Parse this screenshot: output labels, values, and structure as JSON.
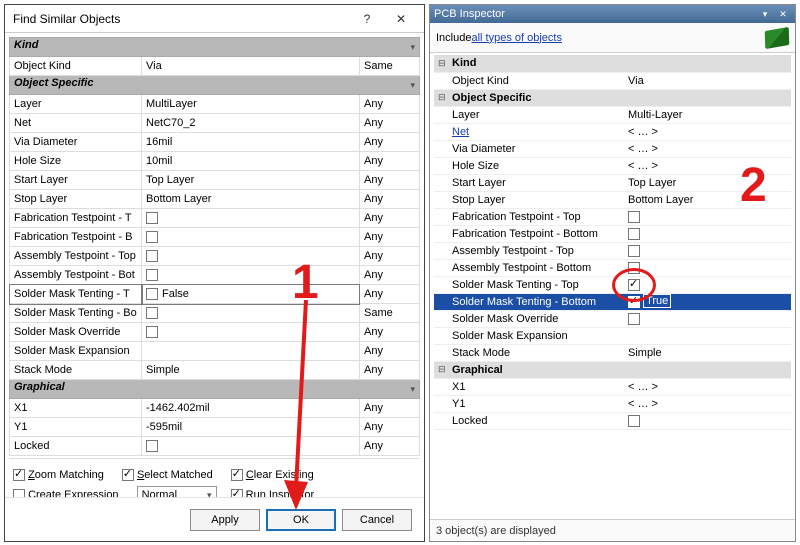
{
  "dialog": {
    "title": "Find Similar Objects",
    "sections": {
      "kind": {
        "header": "Kind",
        "rows": [
          {
            "label": "Object Kind",
            "value": "Via",
            "match": "Same"
          }
        ]
      },
      "obj": {
        "header": "Object Specific",
        "rows": [
          {
            "label": "Layer",
            "value": "MultiLayer",
            "match": "Any"
          },
          {
            "label": "Net",
            "value": "NetC70_2",
            "match": "Any"
          },
          {
            "label": "Via Diameter",
            "value": "16mil",
            "match": "Any"
          },
          {
            "label": "Hole Size",
            "value": "10mil",
            "match": "Any"
          },
          {
            "label": "Start Layer",
            "value": "Top Layer",
            "match": "Any"
          },
          {
            "label": "Stop Layer",
            "value": "Bottom Layer",
            "match": "Any"
          },
          {
            "label": "Fabrication Testpoint - T",
            "value": "",
            "match": "Any",
            "chk": false
          },
          {
            "label": "Fabrication Testpoint - B",
            "value": "",
            "match": "Any",
            "chk": false
          },
          {
            "label": "Assembly Testpoint - Top",
            "value": "",
            "match": "Any",
            "chk": false
          },
          {
            "label": "Assembly Testpoint - Bot",
            "value": "",
            "match": "Any",
            "chk": false
          },
          {
            "label": "Solder Mask Tenting - T",
            "value": "False",
            "match": "Any",
            "chk": false,
            "editing": true
          },
          {
            "label": "Solder Mask Tenting - Bo",
            "value": "",
            "match": "Same",
            "chk": false
          },
          {
            "label": "Solder Mask Override",
            "value": "",
            "match": "Any",
            "chk": false
          },
          {
            "label": "Solder Mask Expansion",
            "value": "",
            "match": "Any"
          },
          {
            "label": "Stack Mode",
            "value": "Simple",
            "match": "Any"
          }
        ]
      },
      "graph": {
        "header": "Graphical",
        "rows": [
          {
            "label": "X1",
            "value": "-1462.402mil",
            "match": "Any"
          },
          {
            "label": "Y1",
            "value": "-595mil",
            "match": "Any"
          },
          {
            "label": "Locked",
            "value": "",
            "match": "Any",
            "chk": false
          }
        ]
      }
    },
    "options": {
      "zoom_matching": "oom Matching",
      "zoom_matching_u": "Z",
      "select_matched": "elect Matched",
      "select_matched_u": "S",
      "clear_existing": "lear Existing",
      "clear_existing_u": "C",
      "create_expression": "Create Expression",
      "combo": "Normal",
      "run_inspector": "un Inspector",
      "run_inspector_u": "R"
    },
    "buttons": {
      "apply": "Apply",
      "ok": "OK",
      "cancel": "Cancel"
    }
  },
  "inspector": {
    "title": "PCB Inspector",
    "include_prefix": "Include ",
    "include_link": "all types of objects",
    "sections": {
      "kind": {
        "header": "Kind",
        "rows": [
          {
            "label": "Object Kind",
            "value": "Via"
          }
        ]
      },
      "obj": {
        "header": "Object Specific",
        "rows": [
          {
            "label": "Layer",
            "value": "Multi-Layer"
          },
          {
            "label": "Net",
            "value": "< … >",
            "link": true
          },
          {
            "label": "Via Diameter",
            "value": "< … >"
          },
          {
            "label": "Hole Size",
            "value": "< … >"
          },
          {
            "label": "Start Layer",
            "value": "Top Layer"
          },
          {
            "label": "Stop Layer",
            "value": "Bottom Layer"
          },
          {
            "label": "Fabrication Testpoint - Top",
            "chk": false
          },
          {
            "label": "Fabrication Testpoint - Bottom",
            "chk": false
          },
          {
            "label": "Assembly Testpoint - Top",
            "chk": false
          },
          {
            "label": "Assembly Testpoint - Bottom",
            "chk": false
          },
          {
            "label": "Solder Mask Tenting - Top",
            "chk": true
          },
          {
            "label": "Solder Mask Tenting - Bottom",
            "chk": true,
            "value": "True",
            "selected": true
          },
          {
            "label": "Solder Mask Override",
            "chk": false
          },
          {
            "label": "Solder Mask Expansion",
            "value": ""
          },
          {
            "label": "Stack Mode",
            "value": "Simple"
          }
        ]
      },
      "graph": {
        "header": "Graphical",
        "rows": [
          {
            "label": "X1",
            "value": "< … >"
          },
          {
            "label": "Y1",
            "value": "< … >"
          },
          {
            "label": "Locked",
            "chk": false
          }
        ]
      }
    },
    "status": "3 object(s) are displayed"
  },
  "annotations": {
    "one": "1",
    "two": "2"
  }
}
